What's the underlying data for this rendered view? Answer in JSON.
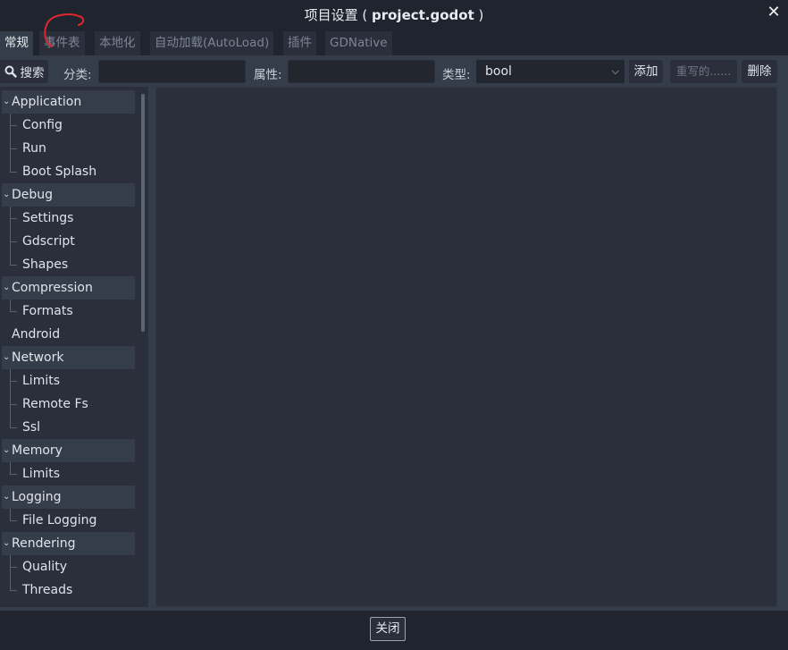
{
  "window": {
    "title_prefix": "项目设置 ( ",
    "title_file": "project.godot",
    "title_suffix": " )",
    "close_glyph": "✕"
  },
  "tabs": [
    {
      "label": "常规",
      "active": true
    },
    {
      "label": "事件表",
      "active": false
    },
    {
      "label": "本地化",
      "active": false
    },
    {
      "label": "自动加载(AutoLoad)",
      "active": false
    },
    {
      "label": "插件",
      "active": false
    },
    {
      "label": "GDNative",
      "active": false
    }
  ],
  "toolbar": {
    "search_label": "搜索",
    "category_label": "分类:",
    "category_value": "",
    "property_label": "属性:",
    "property_value": "",
    "type_label": "类型:",
    "type_value": "bool",
    "add_label": "添加",
    "override_label": "重写的......",
    "delete_label": "删除"
  },
  "tree": {
    "sections": [
      {
        "label": "Application",
        "children": [
          "Config",
          "Run",
          "Boot Splash"
        ]
      },
      {
        "label": "Debug",
        "children": [
          "Settings",
          "Gdscript",
          "Shapes"
        ]
      },
      {
        "label": "Compression",
        "children": [
          "Formats"
        ]
      },
      {
        "label": "Android",
        "children": []
      },
      {
        "label": "Network",
        "children": [
          "Limits",
          "Remote Fs",
          "Ssl"
        ]
      },
      {
        "label": "Memory",
        "children": [
          "Limits"
        ]
      },
      {
        "label": "Logging",
        "children": [
          "File Logging"
        ]
      },
      {
        "label": "Rendering",
        "children": [
          "Quality",
          "Threads"
        ]
      }
    ]
  },
  "footer": {
    "close_label": "关闭"
  },
  "colors": {
    "background": "#20242e",
    "panel": "#363d4a",
    "field": "#2a2f3b",
    "annotation": "#e0262e"
  }
}
